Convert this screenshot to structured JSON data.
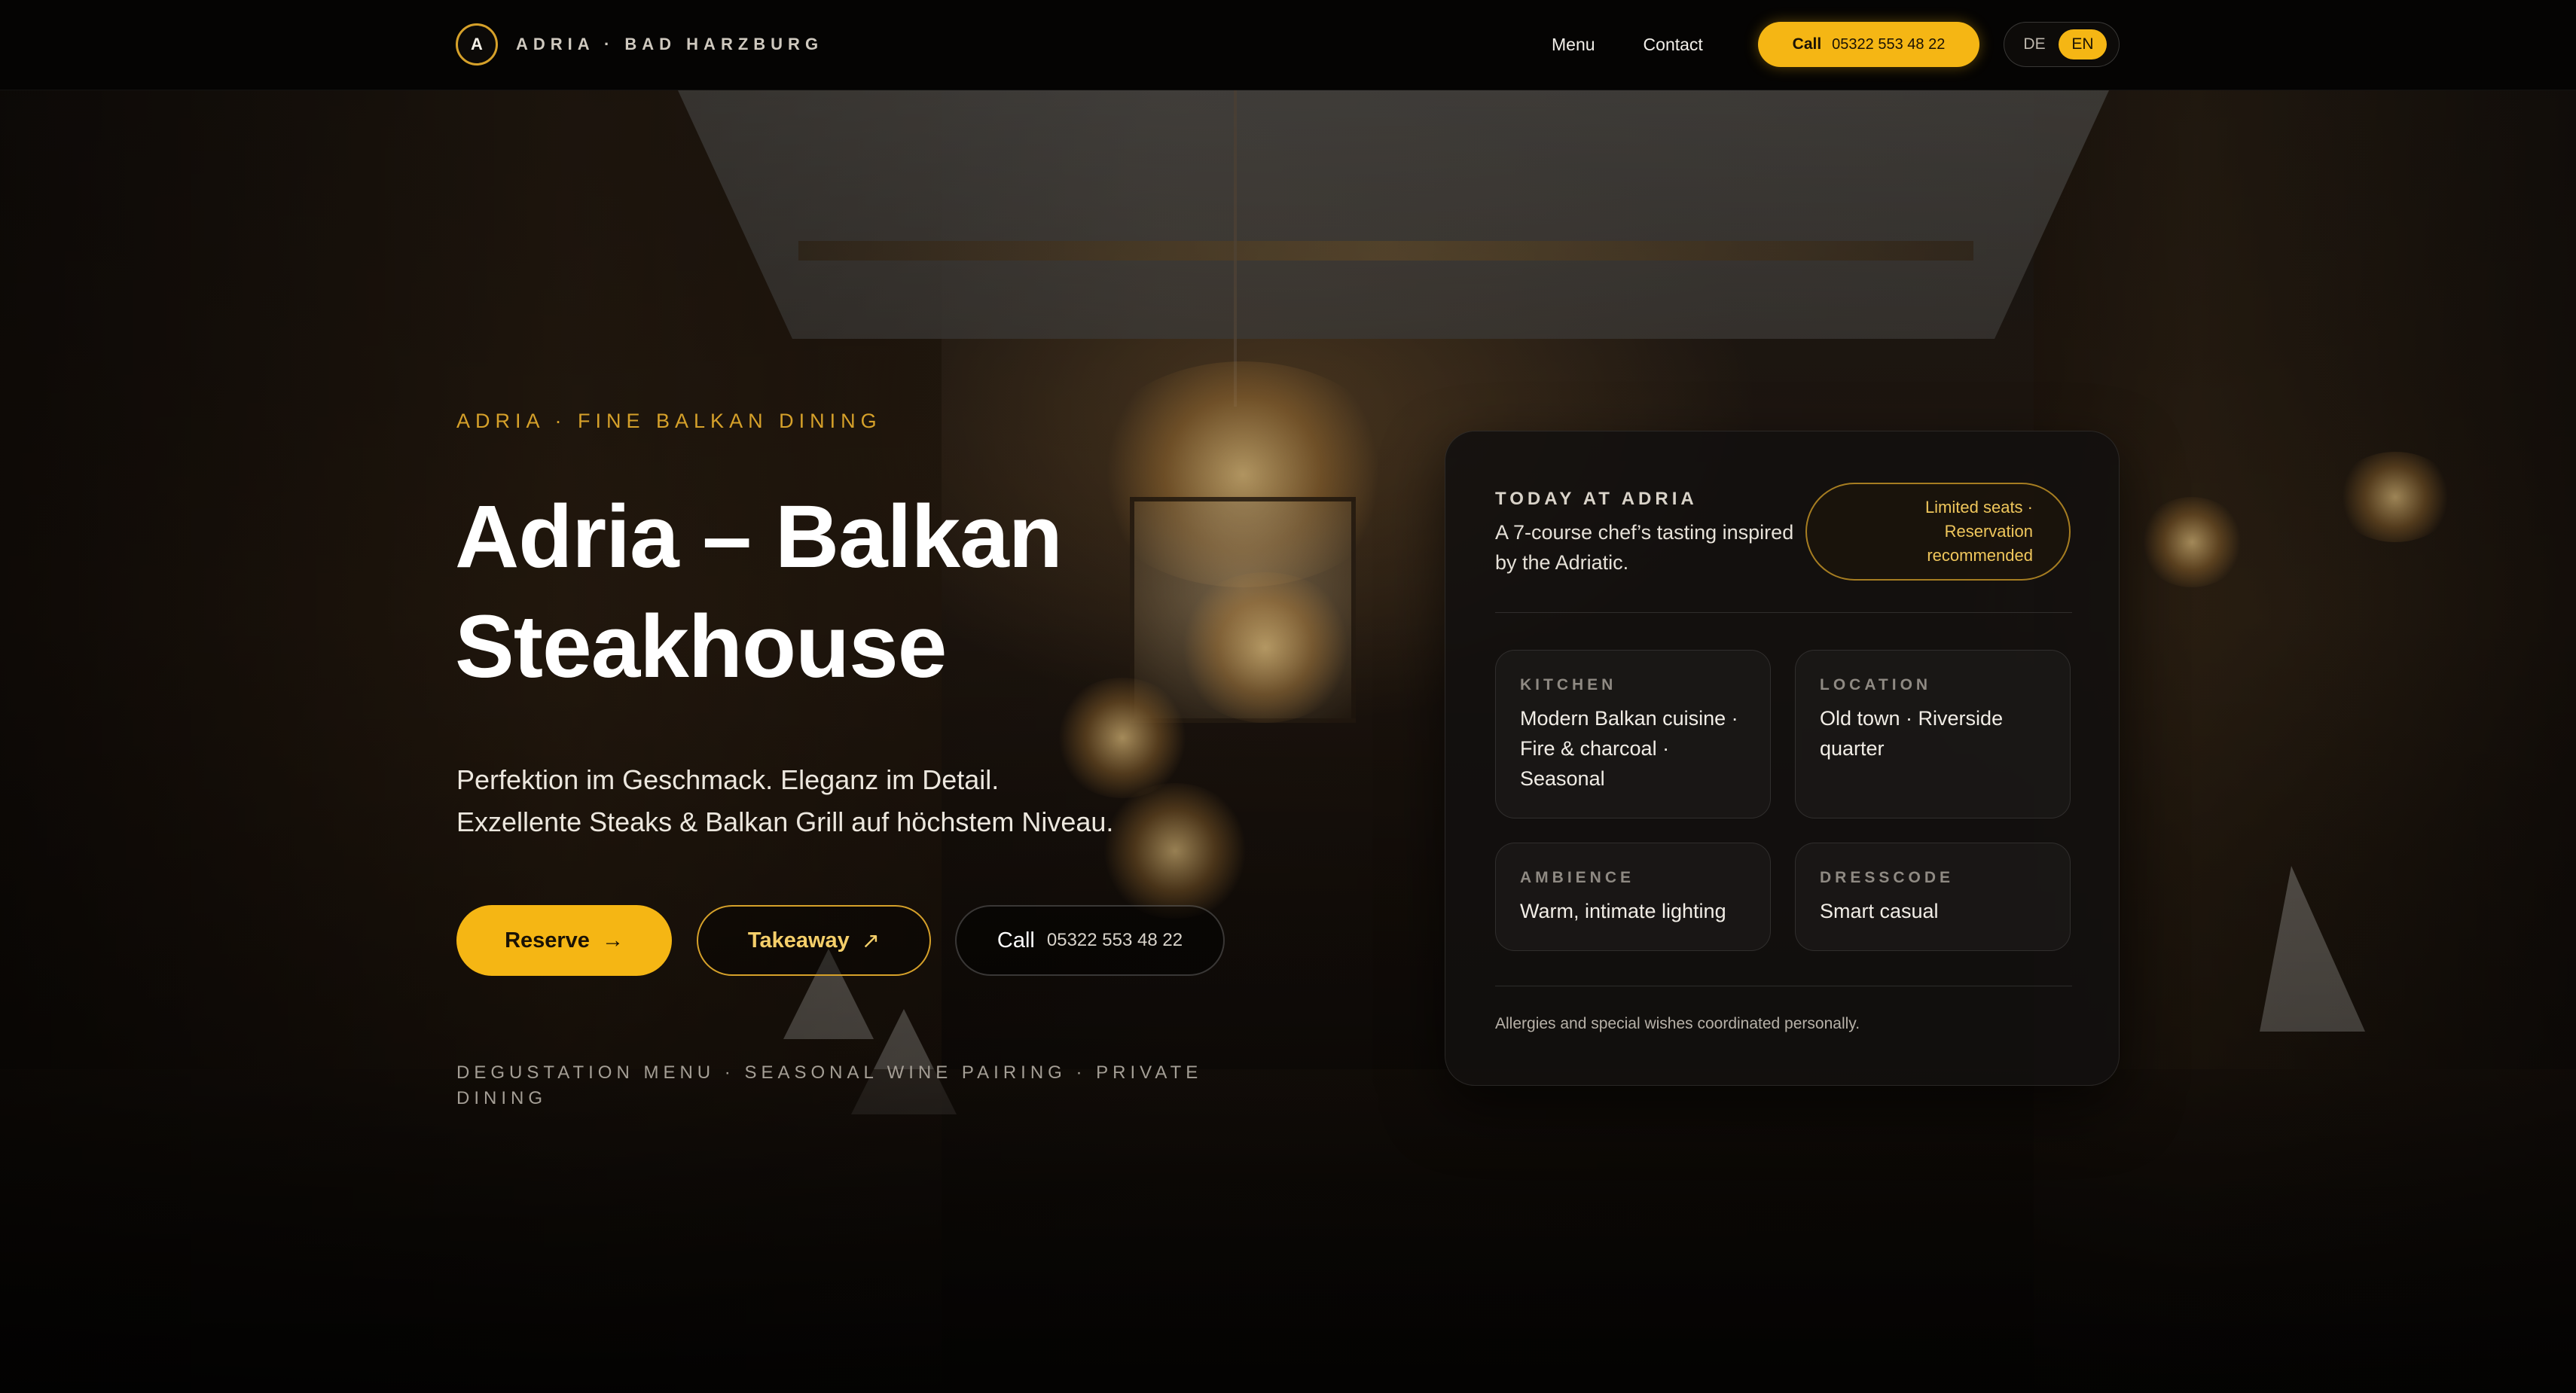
{
  "nav": {
    "brand_mark": "A",
    "brand_text": "ADRIA · BAD HARZBURG",
    "links": [
      {
        "label": "Menu"
      },
      {
        "label": "Contact"
      }
    ],
    "call_label": "Call",
    "call_number": "05322 553 48 22",
    "languages": [
      {
        "code": "DE",
        "active": false
      },
      {
        "code": "EN",
        "active": true
      }
    ]
  },
  "hero": {
    "eyebrow": "ADRIA · FINE BALKAN DINING",
    "title": "Adria – Balkan Steakhouse",
    "subtitle_line1": "Perfektion im Geschmack. Eleganz im Detail.",
    "subtitle_line2": "Exzellente Steaks & Balkan Grill auf höchstem Niveau.",
    "reserve_label": "Reserve",
    "reserve_arrow": "→",
    "takeaway_label": "Takeaway",
    "takeaway_arrow": "↗",
    "call_label": "Call",
    "call_number": "05322 553 48 22",
    "features": "DEGUSTATION MENU · SEASONAL WINE PAIRING · PRIVATE DINING"
  },
  "card": {
    "label": "TODAY AT ADRIA",
    "description": "A 7-course chef’s tasting inspired by the Adriatic.",
    "pill": "Limited seats · Reservation recommended",
    "tiles": [
      {
        "label": "KITCHEN",
        "value": "Modern Balkan cuisine · Fire & charcoal · Seasonal"
      },
      {
        "label": "LOCATION",
        "value": "Old town · Riverside quarter"
      },
      {
        "label": "AMBIENCE",
        "value": "Warm, intimate lighting"
      },
      {
        "label": "DRESSCODE",
        "value": "Smart casual"
      }
    ],
    "footnote": "Allergies and special wishes coordinated personally."
  },
  "colors": {
    "accent": "#f5b614",
    "accent_text": "#d6a12a",
    "background": "#050403"
  },
  "icons": {
    "reserve": "arrow-right-icon",
    "takeaway": "arrow-up-right-icon"
  }
}
